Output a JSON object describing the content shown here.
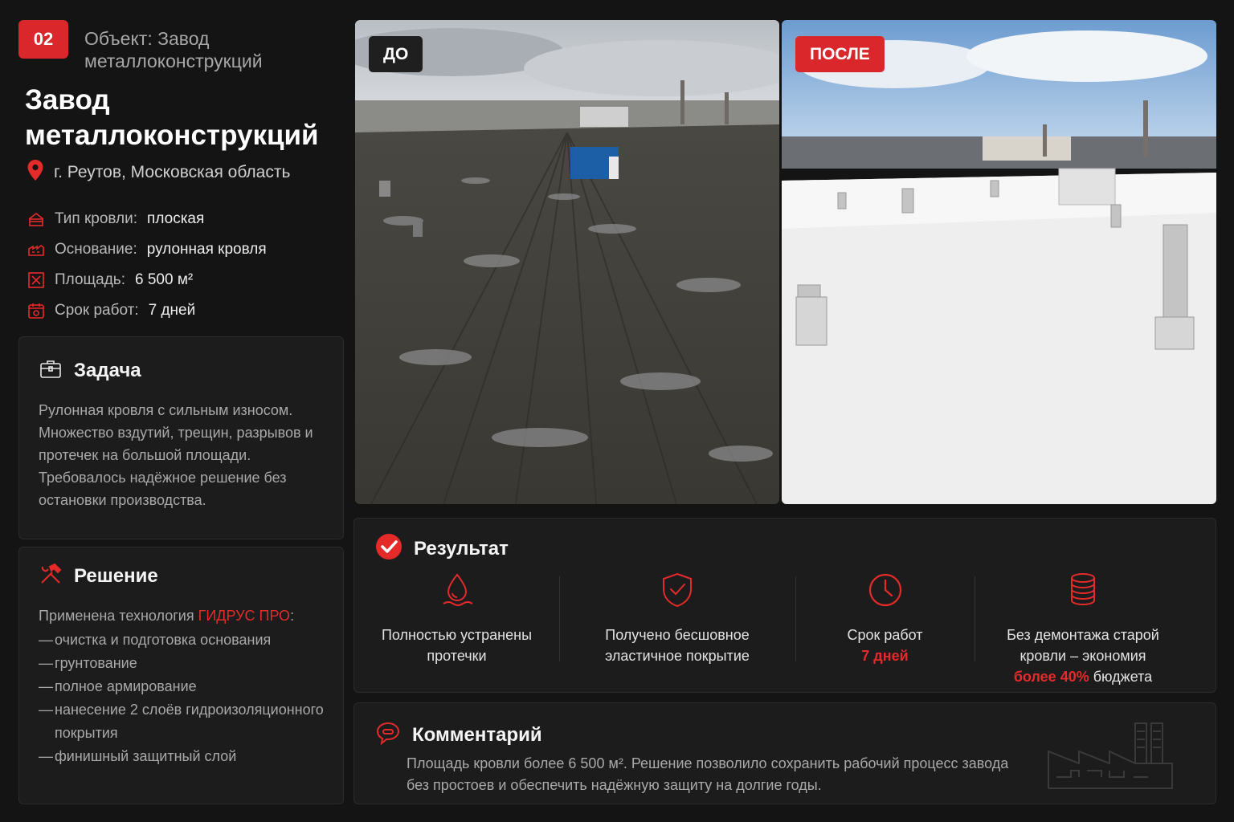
{
  "header": {
    "number": "02",
    "object_label": "Объект: Завод металлоконструкций",
    "title": "Завод металлоконструкций",
    "location": "г. Реутов, Московская область"
  },
  "info": [
    {
      "icon": "roof-icon",
      "label": "Тип кровли:",
      "value": "плоская"
    },
    {
      "icon": "base-icon",
      "label": "Основание:",
      "value": "рулонная кровля"
    },
    {
      "icon": "area-icon",
      "label": "Площадь:",
      "value": "6 500 м²"
    },
    {
      "icon": "calendar-icon",
      "label": "Срок работ:",
      "value": " 7 дней"
    }
  ],
  "task": {
    "title": "Задача",
    "text": "Рулонная кровля с сильным износом. Множество вздутий, трещин, разрывов и протечек на большой площади. Требовалось надёжное решение без остановки производства."
  },
  "solution": {
    "title": "Решение",
    "intro_prefix": "Применена технология ",
    "intro_highlight": "ГИДРУС ПРО",
    "intro_suffix": ":",
    "steps": [
      "очистка и подготовка основания",
      "грунтование",
      "полное армирование",
      "нанесение 2 слоёв гидроизоляционного покрытия",
      "финишный защитный слой"
    ]
  },
  "photos": {
    "before_label": "ДО",
    "after_label": "ПОСЛЕ"
  },
  "result": {
    "title": "Результат",
    "items": [
      {
        "icon": "drop-icon",
        "line1": "Полностью устранены",
        "line2": "протечки"
      },
      {
        "icon": "shield-check-icon",
        "line1": "Получено бесшовное",
        "line2": "эластичное покрытие"
      },
      {
        "icon": "clock-icon",
        "line1": "Срок работ",
        "highlight": "7 дней"
      },
      {
        "icon": "coins-icon",
        "line1": "Без демонтажа старой",
        "line2": "кровли – экономия",
        "highlight": "более 40%",
        "suffix": " бюджета"
      }
    ]
  },
  "comment": {
    "title": "Комментарий",
    "text": "Площадь кровли более 6 500 м². Решение позволило сохранить рабочий процесс завода без простоев и обеспечить надёжную защиту на долгие годы."
  },
  "colors": {
    "accent": "#d9272b",
    "background": "#141414",
    "card": "#1c1c1d"
  }
}
